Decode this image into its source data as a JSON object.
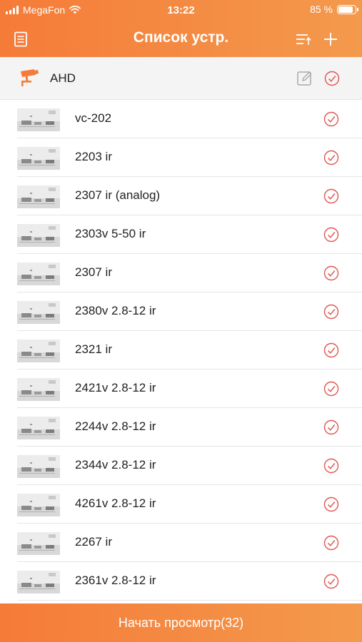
{
  "status_bar": {
    "carrier": "MegaFon",
    "time": "13:22",
    "battery": "85 %",
    "battery_level": 0.85
  },
  "nav": {
    "title": "Список устр.",
    "left_icon": "list-menu-icon",
    "right_icons": [
      "sort-icon",
      "plus-icon"
    ]
  },
  "group": {
    "name": "AHD",
    "icon": "camera-icon",
    "edit_icon": "edit-icon",
    "checked": true
  },
  "devices": [
    {
      "name": "vc-202"
    },
    {
      "name": "2203 ir"
    },
    {
      "name": "2307 ir (analog)"
    },
    {
      "name": "2303v 5-50 ir"
    },
    {
      "name": "2307 ir"
    },
    {
      "name": "2380v 2.8-12 ir"
    },
    {
      "name": "2321 ir"
    },
    {
      "name": "2421v 2.8-12 ir"
    },
    {
      "name": "2244v 2.8-12 ir"
    },
    {
      "name": "2344v 2.8-12 ir"
    },
    {
      "name": "4261v 2.8-12 ir"
    },
    {
      "name": "2267 ir"
    },
    {
      "name": "2361v 2.8-12 ir"
    }
  ],
  "bottom_button": {
    "label": "Начать просмотр(32)"
  },
  "colors": {
    "accent": "#f57b38",
    "check": "#e0574f"
  }
}
